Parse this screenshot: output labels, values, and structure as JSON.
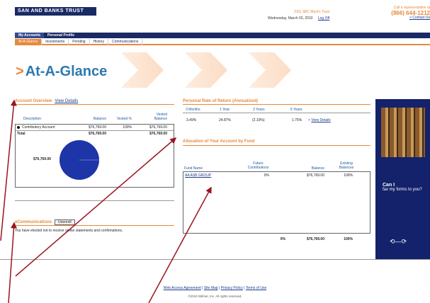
{
  "header": {
    "logo_text": "SAN AND BANKS TRUST",
    "company": "ZSG SBC Muni's Trust",
    "date": "Wednesday, March 03, 2010",
    "logoff": "Log Off",
    "call_text": "Call a representative at",
    "phone": "(866) 644-1212",
    "contact": "> Contact Us"
  },
  "nav": {
    "primary": [
      "My Accounts",
      "Personal Profile"
    ],
    "secondary": [
      "At-A-Glance",
      "Investments",
      "Pending",
      "History",
      "Communications"
    ]
  },
  "page_title": "At-A-Glance",
  "account_overview": {
    "title": "Account Overview",
    "view_details": "View Details",
    "columns": [
      "Description",
      "Balance",
      "Vested %",
      "Vested Balance"
    ],
    "rows": [
      {
        "description": "Contributory Account",
        "balance": "$76,769.00",
        "vested_pct": "100%",
        "vested_balance": "$76,769.00"
      }
    ],
    "total": {
      "label": "Total",
      "balance": "$76,769.00",
      "vested_balance": "$76,769.00"
    },
    "pie_label": "$76,769.00",
    "pie_color": "#1e35a8"
  },
  "ecommunications": {
    "title": "eCommunications",
    "button": "Unenroll",
    "text": "You have elected not to receive online statements and confirmations."
  },
  "rate_of_return": {
    "title": "Personal Rate of Return (Annualized)",
    "columns": [
      "3 Months",
      "1 Year",
      "3 Years",
      "5 Years"
    ],
    "values": [
      "3.49%",
      "24.87%",
      "(2.10%)",
      "1.75%"
    ],
    "view_details": "View Details"
  },
  "allocation": {
    "title": "Allocation of Your Account by Fund",
    "columns": [
      "Fund Name",
      "Future Contributions",
      "Balance",
      "Existing Balances"
    ],
    "rows": [
      {
        "fund": "AA ASB GROUP",
        "future": "0%",
        "balance": "$76,769.00",
        "existing": "100%"
      }
    ],
    "total": {
      "future": "0%",
      "balance": "$76,769.00",
      "existing": "100%"
    }
  },
  "side_promo": {
    "headline": "Can I",
    "text": "fax my forms to you?",
    "arrow": "⟲—⟳"
  },
  "footer": {
    "links": [
      "Web Access Agreement",
      "Site Map",
      "Privacy Policy",
      "Terms of Use"
    ],
    "copyright": "©2010 Wilmer, Inc. All rights reserved."
  }
}
